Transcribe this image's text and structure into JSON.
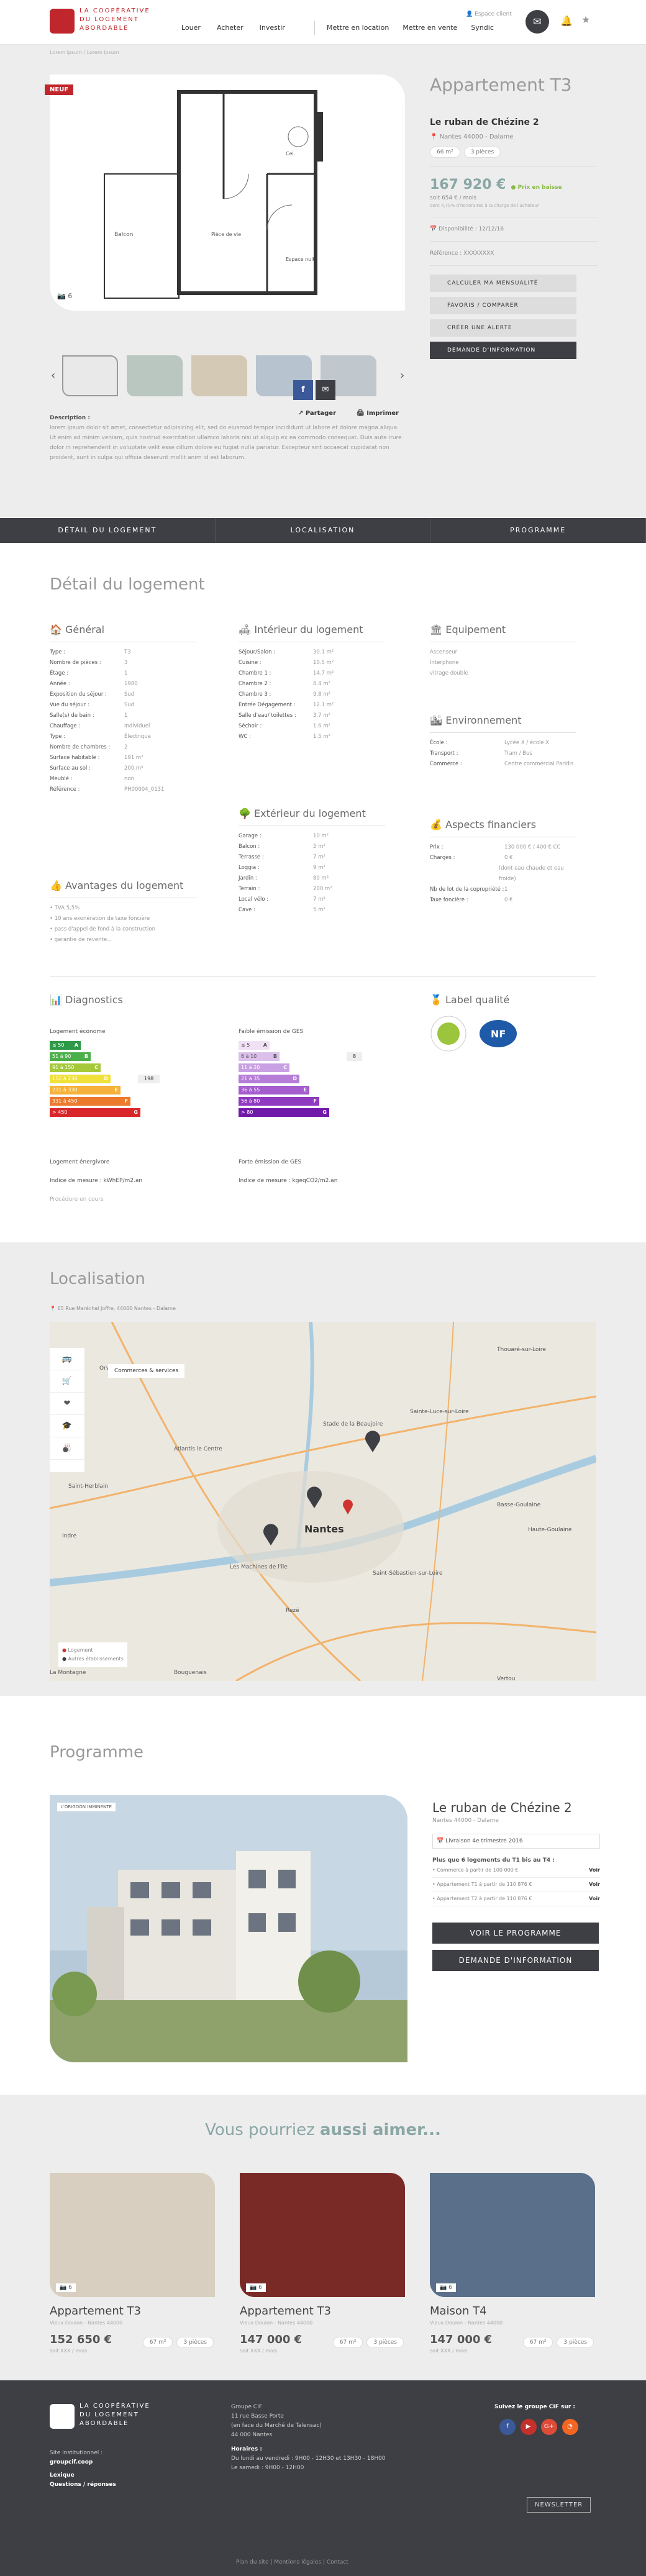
{
  "header": {
    "logo_lines": [
      "LA COOPÉRATIVE",
      "DU LOGEMENT",
      "ABORDABLE"
    ],
    "nav": [
      "Louer",
      "Acheter",
      "Investir"
    ],
    "nav2": [
      "Mettre en location",
      "Mettre en vente",
      "Syndic"
    ],
    "espace": "Espace client"
  },
  "crumb": "Lorem ipsum / Lorem ipsum",
  "badge": "NEUF",
  "photo_count": "6",
  "share": {
    "fb": "f",
    "mail": "✉",
    "partager": "Partager",
    "imprimer": "Imprimer",
    "tooltip": "Partager"
  },
  "desc": {
    "title": "Description :",
    "text": "lorem ipsum dolor sit amet, consectetur adipisicing elit, sed do eiusmod tempor incididunt ut labore et dolore magna aliqua. Ut enim ad minim veniam, quis nostrud exercitation ullamco laboris nisi ut aliquip ex ea commodo consequat. Duis aute irure dolor in reprehenderit in voluptate velit esse cillum dolore eu fugiat nulla pariatur. Excepteur sint occaecat cupidatat non proident, sunt in culpa qui officia deserunt mollit anim id est laborum."
  },
  "plan": {
    "balcon": "Balcon",
    "piece": "Pièce de vie",
    "cel": "Cel.",
    "espace": "Espace nuit"
  },
  "right": {
    "title": "Appartement T3",
    "residence": "Le ruban de Chézine 2",
    "loc": "Nantes 44000 - Dalame",
    "surface": "66 m²",
    "pieces": "3 pièces",
    "price": "167 920 €",
    "price_tag": "Prix en baisse",
    "mo": "soit 654 € / mois",
    "mo_small": "dont 4,70% d'honoraires à la charge de l'acheteur",
    "dispo": "Disponibilité : 12/12/16",
    "ref": "Référence : XXXXXXXX",
    "btns": [
      "CALCULER MA MENSUALITÉ",
      "FAVORIS / COMPARER",
      "CRÉER UNE ALERTE",
      "DEMANDE D'INFORMATION"
    ]
  },
  "tabs": [
    "DÉTAIL DU LOGEMENT",
    "LOCALISATION",
    "PROGRAMME"
  ],
  "detail": {
    "title": "Détail du logement",
    "general": {
      "h": "Général",
      "rows": [
        [
          "Type :",
          "T3"
        ],
        [
          "Nombre de pièces :",
          "3"
        ],
        [
          "Étage :",
          "1"
        ],
        [
          "Année :",
          "1980"
        ],
        [
          "Exposition du séjour :",
          "Sud"
        ],
        [
          "Vue du séjour :",
          "Sud"
        ],
        [
          "Salle(s) de bain :",
          "1"
        ],
        [
          "Chauffage :",
          "Individuel"
        ],
        [
          "Type :",
          "Électrique"
        ],
        [
          "Nombre de chambres :",
          "2"
        ],
        [
          "Surface habitable :",
          "191 m²"
        ],
        [
          "Surface au sol :",
          "200 m²"
        ],
        [
          "Meublé :",
          "non"
        ],
        [
          "Référence :",
          "PH00004_0131"
        ]
      ]
    },
    "interieur": {
      "h": "Intérieur du logement",
      "rows": [
        [
          "Séjour/Salon :",
          "30.1 m²"
        ],
        [
          "Cuisine :",
          "10.5 m²"
        ],
        [
          "Chambre 1 :",
          "14.7 m²"
        ],
        [
          "Chambre 2 :",
          "8.4 m²"
        ],
        [
          "Chambre 3 :",
          "9.8 m²"
        ],
        [
          "Entrée Dégagement :",
          "12.1 m²"
        ],
        [
          "Salle d'eau/ toilettes :",
          "3.7 m²"
        ],
        [
          "Séchoir :",
          "1.6 m²"
        ],
        [
          "WC :",
          "1.5 m²"
        ]
      ]
    },
    "exterieur": {
      "h": "Extérieur du logement",
      "rows": [
        [
          "Garage :",
          "10 m²"
        ],
        [
          "Balcon :",
          "5 m²"
        ],
        [
          "Terrasse :",
          "7 m²"
        ],
        [
          "Loggia :",
          "9 m²"
        ],
        [
          "Jardin :",
          "80 m²"
        ],
        [
          "Terrain :",
          "200 m²"
        ],
        [
          "Local vélo :",
          "7 m²"
        ],
        [
          "Cave :",
          "5 m²"
        ]
      ]
    },
    "equipement": {
      "h": "Equipement",
      "rows": [
        "Ascenseur",
        "Interphone",
        "vitrage double"
      ]
    },
    "environnement": {
      "h": "Environnement",
      "rows": [
        [
          "École :",
          "Lycée X / école X"
        ],
        [
          "Transport :",
          "Tram / Bus"
        ],
        [
          "Commerce :",
          "Centre commercial Paridis"
        ]
      ]
    },
    "financiers": {
      "h": "Aspects financiers",
      "rows": [
        [
          "Prix :",
          "130 000 € / 400 € CC"
        ],
        [
          "Charges :",
          "0 €"
        ],
        [
          "",
          "(dont eau chaude et eau froide)"
        ],
        [
          "Nb de lot de la copropriété :",
          "1"
        ],
        [
          "Taxe foncière :",
          "0 €"
        ]
      ]
    },
    "avantages": {
      "h": "Avantages du logement",
      "rows": [
        "• TVA 5,5%",
        "• 10 ans exonération de taxe foncière",
        "• pass d'appel de fond à la construction",
        "• garantie de revente..."
      ]
    },
    "diag": {
      "h": "Diagnostics",
      "energy": "Logement économe",
      "energy_bad": "Logement énergivore",
      "energy_val": "198",
      "energy_idx": "Indice de mesure : kWhEP/m2.an",
      "procedure": "Procédure en cours",
      "ges": "Faible émission de GES",
      "ges_bad": "Forte émission de GES",
      "ges_val": "8",
      "ges_idx": "Indice de mesure : kgeqCO2/m2.an"
    },
    "label": {
      "h": "Label qualité"
    },
    "energy_bars": [
      [
        "≤ 50",
        "A"
      ],
      [
        "51 à 90",
        "B"
      ],
      [
        "91 à 150",
        "C"
      ],
      [
        "151 à 230",
        "D"
      ],
      [
        "231 à 330",
        "E"
      ],
      [
        "331 à 450",
        "F"
      ],
      [
        "> 450",
        "G"
      ]
    ],
    "ges_bars": [
      [
        "≤ 5",
        "A"
      ],
      [
        "6 à 10",
        "B"
      ],
      [
        "11 à 20",
        "C"
      ],
      [
        "21 à 35",
        "D"
      ],
      [
        "36 à 55",
        "E"
      ],
      [
        "56 à 80",
        "F"
      ],
      [
        "> 80",
        "G"
      ]
    ]
  },
  "local": {
    "title": "Localisation",
    "addr": "65 Rue Maréchal Joffre, 44000 Nantes - Dalame",
    "tip": "Commerces & services",
    "legend1": "Logement",
    "legend2": "Autres établissements",
    "city": "Nantes",
    "places": [
      "Orvault",
      "Saint-Herblain",
      "Indre",
      "Rezé",
      "Bouguenais",
      "Sainte-Luce-sur-Loire",
      "Thouaré-sur-Loire",
      "Basse-Goulaine",
      "Haute-Goulaine",
      "Saint-Sébastien-sur-Loire",
      "Vertou",
      "La Montagne",
      "Les Machines de l'île",
      "Stade de la Beaujoire",
      "Atlantis le Centre"
    ]
  },
  "programme": {
    "title": "Programme",
    "exhibit": "L'ORIGOON IMMINENTE",
    "res": "Le ruban de Chézine 2",
    "sub": "Nantes 44000 - Dalame",
    "liv": "Livraison 4e trimestre 2016",
    "plus": "Plus que 6 logements du T1 bis au T4 :",
    "items": [
      [
        "• Commerce à partir de 100 000 €",
        "Voir"
      ],
      [
        "• Appartement T1 à partir de 110 876 €",
        "Voir"
      ],
      [
        "• Appartement T2 à partir de 110 876 €",
        "Voir"
      ]
    ],
    "btn1": "VOIR LE PROGRAMME",
    "btn2": "DEMANDE D'INFORMATION"
  },
  "aimer": {
    "title1": "Vous pourriez ",
    "title2": "aussi aimer...",
    "cards": [
      {
        "t": "Appartement T3",
        "s": "Vieux Doulon - Nantes 44000",
        "p": "152 650 €",
        "m": "soit XXX / mois",
        "a": "67 m²",
        "b": "3 pièces",
        "n": "6"
      },
      {
        "t": "Appartement T3",
        "s": "Vieux Doulon - Nantes 44000",
        "p": "147 000 €",
        "m": "soit XXX / mois",
        "a": "67 m²",
        "b": "3 pièces",
        "n": "6"
      },
      {
        "t": "Maison T4",
        "s": "Vieux Doulon - Nantes 44000",
        "p": "147 000 €",
        "m": "soit XXX / mois",
        "a": "67 m²",
        "b": "3 pièces",
        "n": "6"
      }
    ]
  },
  "footer": {
    "site": "Site institutionnel :",
    "url": "groupcif.coop",
    "lex": "Lexique",
    "qr": "Questions / réponses",
    "addr": [
      "Groupe CIF",
      "11 rue Basse Porte",
      "(en face du Marché de Talensac)",
      "44 000 Nantes"
    ],
    "hours": [
      "Horaires :",
      "Du lundi au vendredi : 9H00 - 12H30 et 13H30 - 18H00",
      "Le samedi : 9H00 - 12H00"
    ],
    "suivez": "Suivez le groupe CIF sur :",
    "news": "NEWSLETTER",
    "links": "Plan du site  |  Mentions légales  |  Contact"
  }
}
